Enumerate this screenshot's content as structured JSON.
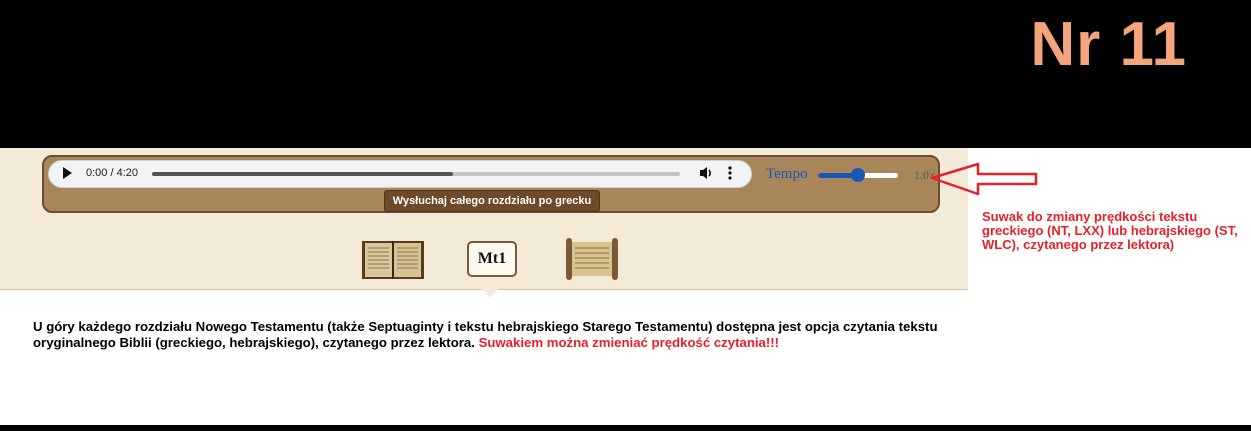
{
  "slide": {
    "number": "Nr 11"
  },
  "audio_player": {
    "time": "0:00 / 4:20",
    "progress_fraction": 0.57,
    "icons": {
      "play": "play-icon",
      "volume": "volume-icon",
      "more": "more-vert-icon"
    }
  },
  "tempo": {
    "label": "Tempo",
    "value": "1.0×",
    "slider_fraction": 0.5
  },
  "listen_button": {
    "label": "Wysłuchaj całego rozdziału po grecku"
  },
  "navigation": {
    "chapter_label": "Mt1",
    "icons": {
      "left": "book-icon",
      "right": "scroll-icon"
    }
  },
  "annotation": {
    "text": "Suwak do zmiany prędkości tekstu greckiego (NT, LXX) lub hebrajskiego (ST, WLC), czytanego przez lektora)",
    "color": "#e8202a"
  },
  "description": {
    "main": "U góry każdego rozdziału Nowego Testamentu (także Septuaginty i tekstu hebrajskiego Starego Testamentu) dostępna jest opcja czytania tekstu oryginalnego Biblii (greckiego, hebrajskiego), czytanego przez lektora.",
    "highlight": "Suwakiem można zmieniać prędkość czytania!!!"
  },
  "colors": {
    "panel": "#a8865a",
    "page": "#f3ead8",
    "tempo_accent": "#1a55b8",
    "slide_number": "#f4a47a"
  }
}
